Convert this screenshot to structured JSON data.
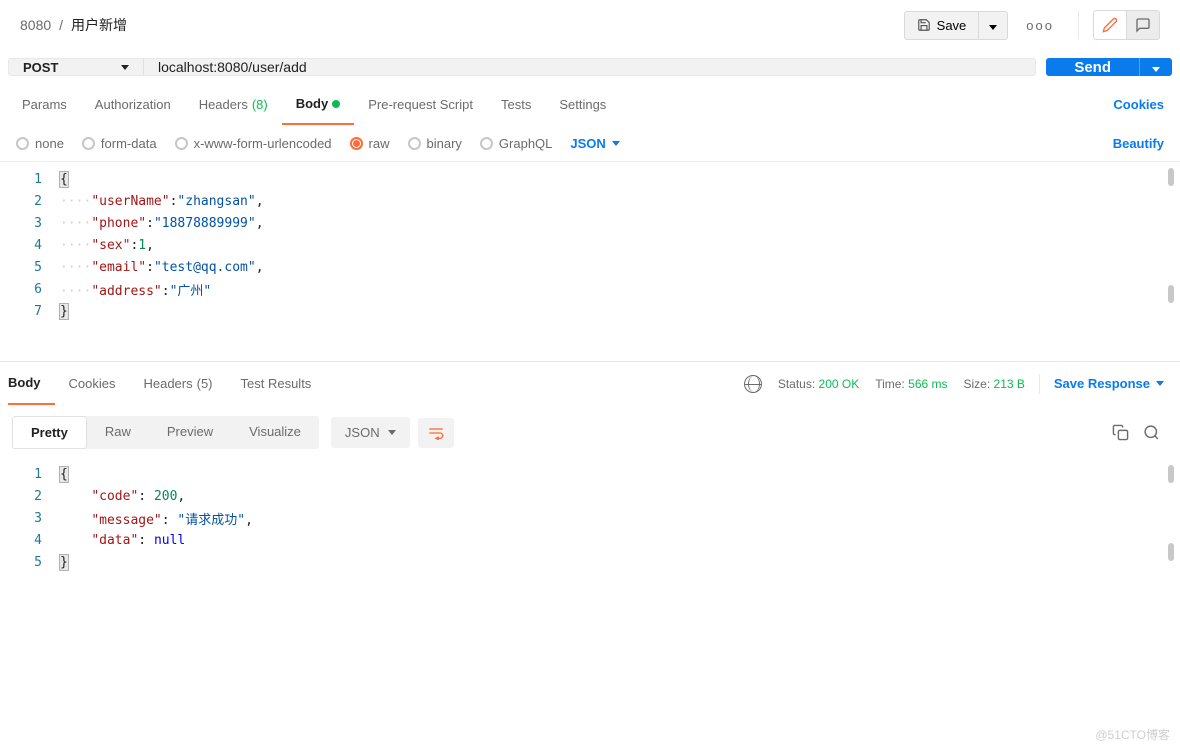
{
  "breadcrumb": {
    "parent": "8080",
    "sep": "/",
    "current": "用户新增"
  },
  "toolbar": {
    "save": "Save",
    "more": "ooo"
  },
  "request": {
    "method": "POST",
    "url": "localhost:8080/user/add",
    "send": "Send"
  },
  "reqTabs": {
    "params": "Params",
    "auth": "Authorization",
    "headers": "Headers",
    "headersCount": "(8)",
    "body": "Body",
    "prereq": "Pre-request Script",
    "tests": "Tests",
    "settings": "Settings",
    "cookies": "Cookies"
  },
  "bodyTypes": {
    "none": "none",
    "formdata": "form-data",
    "urlencoded": "x-www-form-urlencoded",
    "raw": "raw",
    "binary": "binary",
    "graphql": "GraphQL",
    "rawType": "JSON",
    "beautify": "Beautify"
  },
  "reqBody": {
    "userNameKey": "\"userName\"",
    "userNameVal": "\"zhangsan\"",
    "phoneKey": "\"phone\"",
    "phoneVal": "\"18878889999\"",
    "sexKey": "\"sex\"",
    "sexVal": "1",
    "emailKey": "\"email\"",
    "emailVal": "\"test@qq.com\"",
    "addressKey": "\"address\"",
    "addressVal": "\"广州\""
  },
  "respTabs": {
    "body": "Body",
    "cookies": "Cookies",
    "headers": "Headers",
    "headersCount": "(5)",
    "testResults": "Test Results"
  },
  "respMeta": {
    "statusLabel": "Status:",
    "status": "200 OK",
    "timeLabel": "Time:",
    "time": "566 ms",
    "sizeLabel": "Size:",
    "size": "213 B",
    "saveResponse": "Save Response"
  },
  "viewTabs": {
    "pretty": "Pretty",
    "raw": "Raw",
    "preview": "Preview",
    "visualize": "Visualize",
    "type": "JSON"
  },
  "respBody": {
    "codeKey": "\"code\"",
    "codeVal": "200",
    "messageKey": "\"message\"",
    "messageVal": "\"请求成功\"",
    "dataKey": "\"data\"",
    "dataVal": "null"
  },
  "watermark": "@51CTO博客"
}
